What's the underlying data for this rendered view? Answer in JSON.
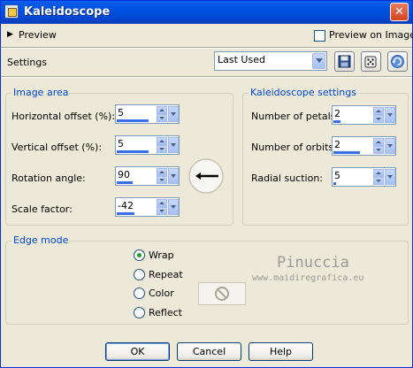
{
  "window": {
    "title": "Kaleidoscope",
    "close_glyph": "✕"
  },
  "preview": {
    "toggle_glyph": "▶",
    "label": "Preview",
    "preview_on_image_label": "Preview on Image"
  },
  "settings": {
    "label": "Settings",
    "preset_value": "Last Used"
  },
  "image_area": {
    "title": "Image area",
    "fields": [
      {
        "label": "Horizontal offset (%):",
        "value": "5"
      },
      {
        "label": "Vertical offset (%):",
        "value": "5"
      },
      {
        "label": "Rotation angle:",
        "value": "90"
      },
      {
        "label": "Scale factor:",
        "value": "-42"
      }
    ]
  },
  "kaleidoscope_settings": {
    "title": "Kaleidoscope settings",
    "fields": [
      {
        "label": "Number of petals:",
        "value": "2"
      },
      {
        "label": "Number of orbits:",
        "value": "2"
      },
      {
        "label": "Radial suction:",
        "value": "5"
      }
    ]
  },
  "edge_mode": {
    "title": "Edge mode",
    "options": [
      "Wrap",
      "Repeat",
      "Color",
      "Reflect"
    ],
    "selected": "Wrap"
  },
  "watermark": {
    "name": "Pinuccia",
    "url": "www.maidiregrafica.eu"
  },
  "buttons": {
    "ok": "OK",
    "cancel": "Cancel",
    "help": "Help"
  }
}
